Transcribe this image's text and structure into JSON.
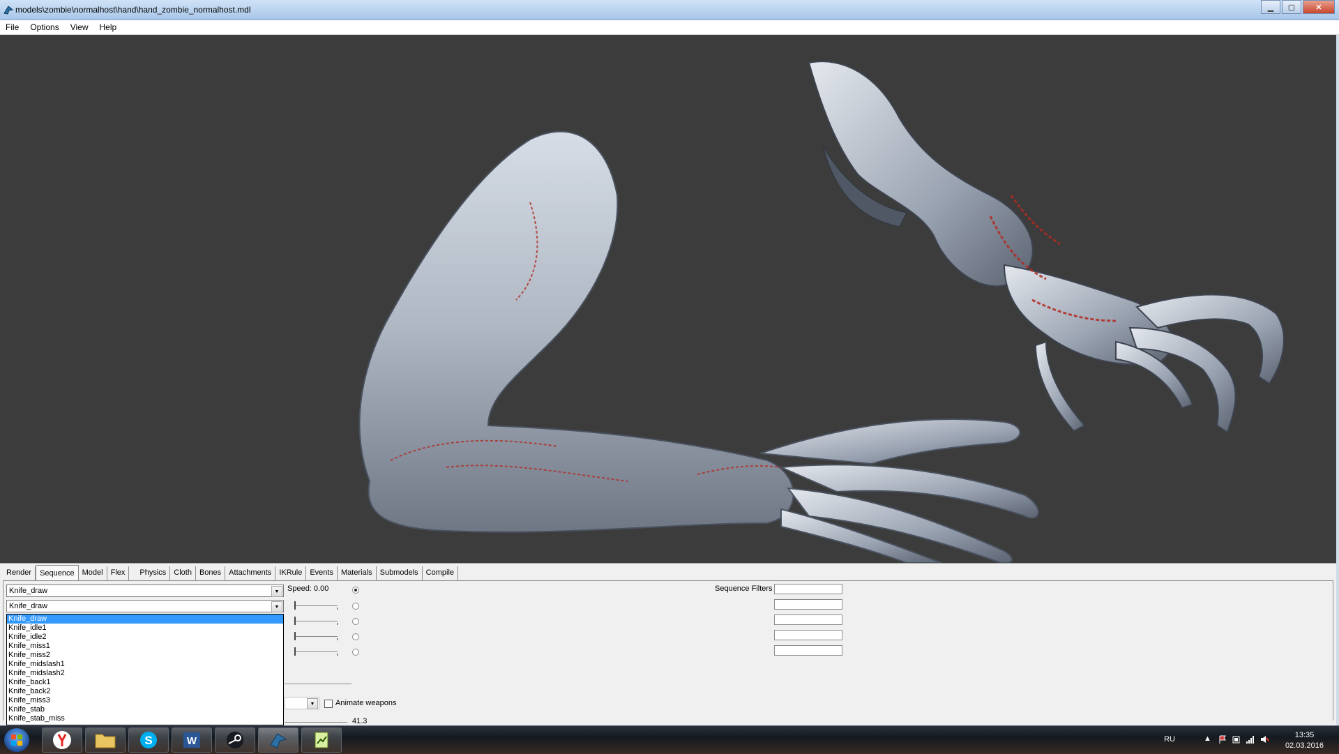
{
  "window": {
    "title": "models\\zombie\\normalhost\\hand\\hand_zombie_normalhost.mdl"
  },
  "menu": [
    "File",
    "Options",
    "View",
    "Help"
  ],
  "tabs": [
    "Render",
    "Sequence",
    "Model",
    "Flex",
    "Physics",
    "Cloth",
    "Bones",
    "Attachments",
    "IKRule",
    "Events",
    "Materials",
    "Submodels",
    "Compile"
  ],
  "sequence": {
    "combo1_value": "Knife_draw",
    "combo2_value": "Knife_draw",
    "speed_label": "Speed: 0.00",
    "filters_label": "Sequence Filters",
    "animate_weapons_label": "Animate weapons",
    "frame_value": "41.3",
    "dropdown_items": [
      "Knife_draw",
      "Knife_idle1",
      "Knife_idle2",
      "Knife_miss1",
      "Knife_miss2",
      "Knife_midslash1",
      "Knife_midslash2",
      "Knife_back1",
      "Knife_back2",
      "Knife_miss3",
      "Knife_stab",
      "Knife_stab_miss"
    ],
    "selected_index": 0
  },
  "taskbar": {
    "apps": [
      "yandex-browser",
      "file-explorer",
      "skype",
      "word",
      "steam",
      "hlmv",
      "notepad"
    ],
    "lang": "RU",
    "time": "13:35",
    "date": "02.03.2016"
  },
  "colors": {
    "viewport_bg": "#3c3c3c",
    "selection": "#3399ff"
  }
}
